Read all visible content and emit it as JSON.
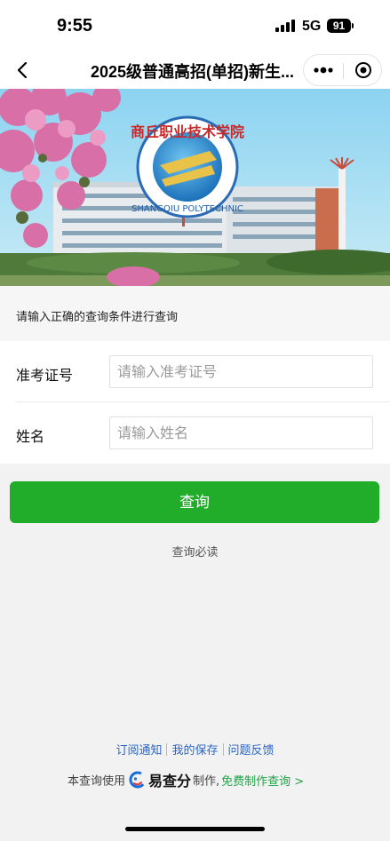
{
  "status_bar": {
    "time": "9:55",
    "network": "5G",
    "battery": "91"
  },
  "nav": {
    "title": "2025级普通高招(单招)新生...",
    "back_icon": "chevron-left-icon",
    "more_icon": "more-dots-icon",
    "close_icon": "target-circle-icon"
  },
  "banner": {
    "school_name_cn": "商丘职业技术学院",
    "school_name_en": "SHANGQIU POLYTECHNIC"
  },
  "form": {
    "hint": "请输入正确的查询条件进行查询",
    "fields": [
      {
        "label": "准考证号",
        "placeholder": "请输入准考证号",
        "value": ""
      },
      {
        "label": "姓名",
        "placeholder": "请输入姓名",
        "value": ""
      }
    ],
    "submit_label": "查询",
    "must_read_label": "查询必读"
  },
  "footer": {
    "links": [
      "订阅通知",
      "我的保存",
      "问题反馈"
    ],
    "credit_prefix": "本查询使用",
    "brand": "易查分",
    "credit_suffix": "制作,",
    "free_link": "免费制作查询 >"
  },
  "colors": {
    "primary_green": "#21ad2a",
    "link_blue": "#2a66c8",
    "link_green": "#21a34a"
  }
}
